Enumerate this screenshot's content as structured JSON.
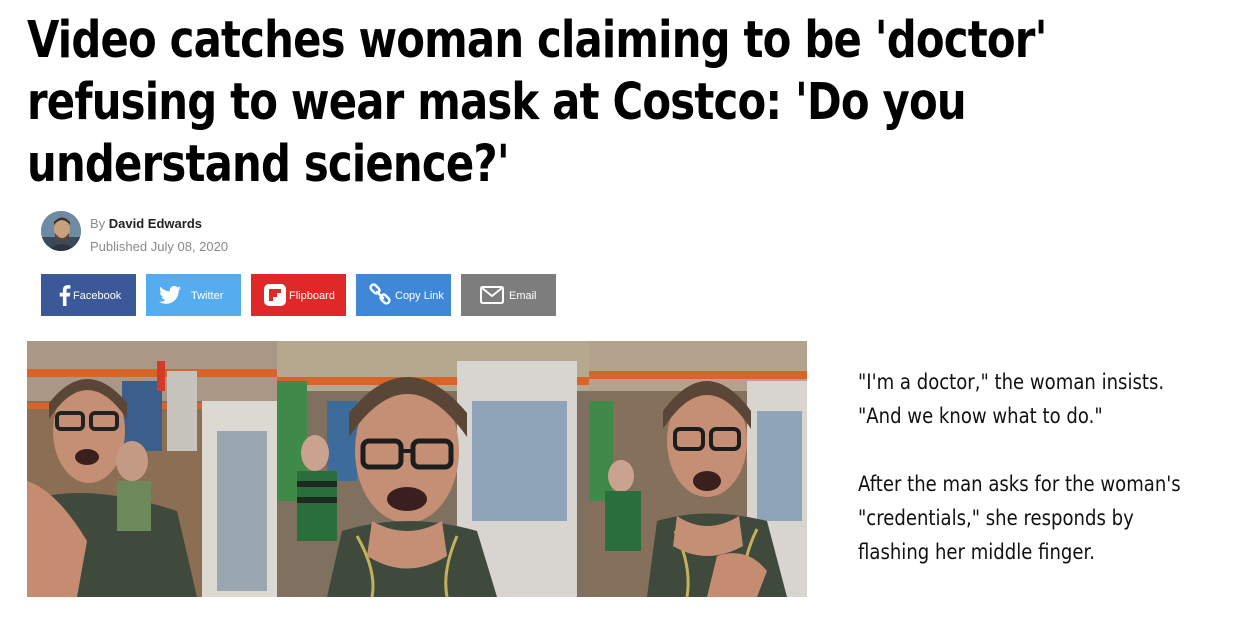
{
  "article": {
    "headline_lines": [
      "Video catches woman claiming to be 'doctor'",
      "refusing to wear mask at Costco: 'Do you",
      "understand science?'"
    ],
    "byline": {
      "by_label": "By",
      "author": "David Edwards",
      "published_label": "Published",
      "published_date": "July 08, 2020"
    },
    "share_buttons": [
      {
        "label": "Facebook",
        "color": "#3b5998",
        "icon": "facebook-icon"
      },
      {
        "label": "Twitter",
        "color": "#55acee",
        "icon": "twitter-icon"
      },
      {
        "label": "Flipboard",
        "color": "#e12828",
        "icon": "flipboard-icon"
      },
      {
        "label": "Copy Link",
        "color": "#3f88d9",
        "icon": "link-icon"
      },
      {
        "label": "Email",
        "color": "#7d7d7d",
        "icon": "email-icon"
      }
    ],
    "caption": {
      "paragraph1_lines": [
        "\"I'm a doctor,\" the woman insists.",
        "\"And we know what to do.\""
      ],
      "paragraph2_lines": [
        "After the man asks for the woman's",
        "\"credentials,\" she responds by",
        "flashing her middle finger."
      ]
    }
  }
}
